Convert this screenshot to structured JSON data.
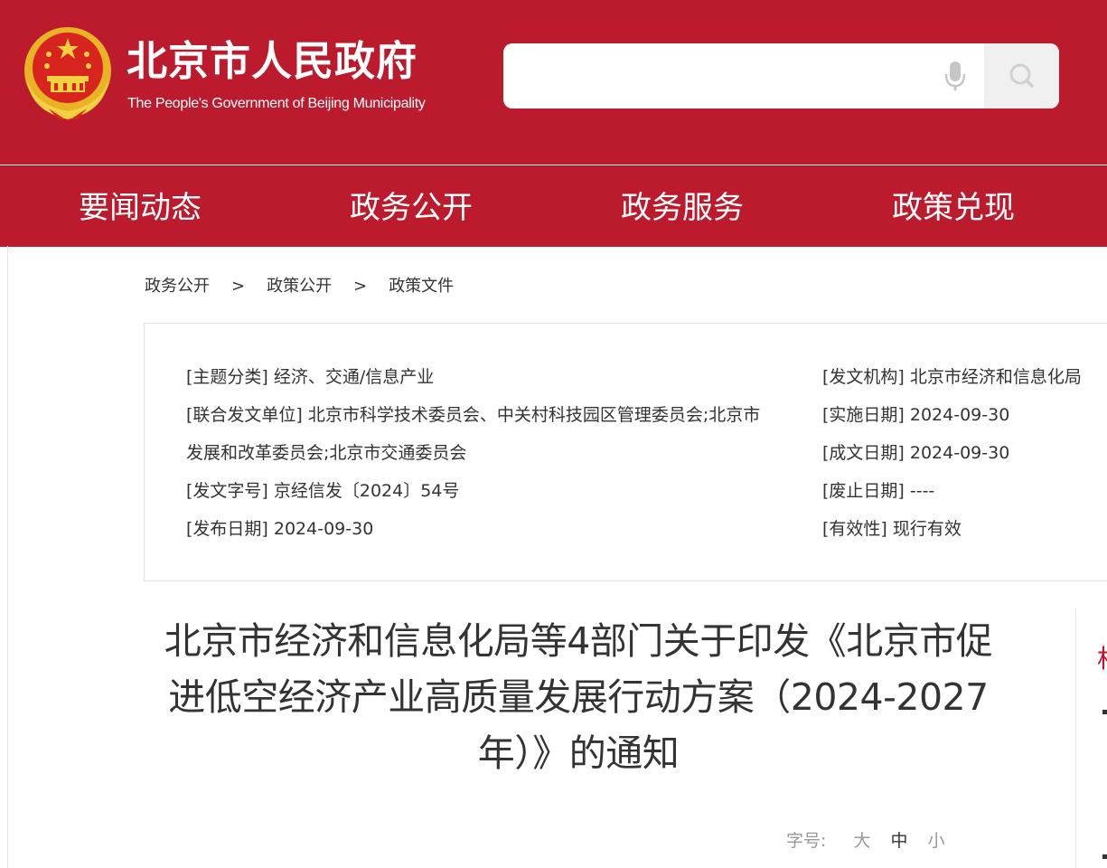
{
  "header": {
    "site_name": "北京市人民政府",
    "site_name_en": "The People's Government of Beijing Municipality",
    "search": {
      "placeholder": "",
      "value": ""
    },
    "colors": {
      "brand_red": "#bc1a2d",
      "search_button_bg": "#f0f0f0"
    },
    "icons": {
      "mic": "microphone-icon",
      "search": "search-icon",
      "emblem": "national-emblem"
    }
  },
  "nav": {
    "items": [
      {
        "label": "要闻动态"
      },
      {
        "label": "政务公开"
      },
      {
        "label": "政务服务"
      },
      {
        "label": "政策兑现"
      }
    ]
  },
  "breadcrumb": {
    "items": [
      "政务公开",
      "政策公开",
      "政策文件"
    ],
    "separator": ">"
  },
  "meta": {
    "topic": "[主题分类] 经济、交通/信息产业",
    "joint_units_line1": "[联合发文单位] 北京市科学技术委员会、中关村科技园区管理委员会;北京市",
    "joint_units_line2": "发展和改革委员会;北京市交通委员会",
    "doc_number": "[发文字号] 京经信发〔2024〕54号",
    "publish_date": "[发布日期] 2024-09-30",
    "issuer": "[发文机构] 北京市经济和信息化局",
    "effective_date": "[实施日期] 2024-09-30",
    "written_date": "[成文日期] 2024-09-30",
    "abolish_date": "[废止日期] ----",
    "validity": "[有效性] 现行有效"
  },
  "document": {
    "title_line1": "北京市经济和信息化局等4部门关于印发《北京市促",
    "title_line2": "进低空经济产业高质量发展行动方案（2024-2027",
    "title_line3": "年）》的通知"
  },
  "font_size": {
    "label": "字号:",
    "large": "大",
    "medium": "中",
    "small": "小",
    "active": "medium"
  },
  "side_panel": {
    "heading_fragment": "相"
  }
}
